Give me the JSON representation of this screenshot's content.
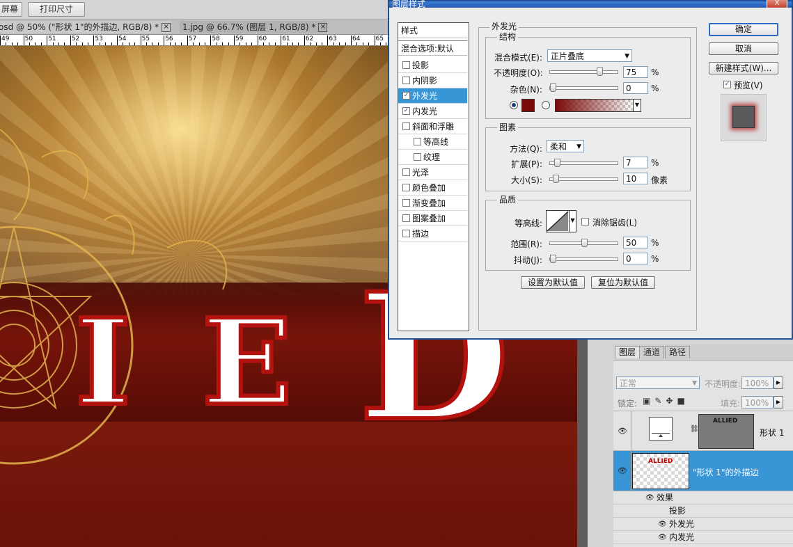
{
  "toolbar": {
    "btn_left": "屏幕",
    "btn_print": "打印尺寸"
  },
  "doc_tabs": [
    {
      "label": "osd @ 50% (\"形状 1\"的外描边, RGB/8) *"
    },
    {
      "label": "1.jpg @ 66.7% (图层 1, RGB/8) *"
    }
  ],
  "ruler": [
    "49",
    "50",
    "51",
    "52",
    "53",
    "54",
    "55",
    "56",
    "57",
    "58",
    "59",
    "60",
    "61",
    "62",
    "63",
    "64",
    "65"
  ],
  "canvas": {
    "letters": [
      "I",
      "E",
      "D"
    ]
  },
  "dialog": {
    "title": "图层样式",
    "close_label": "X",
    "style_list": {
      "header": "样式",
      "blend_default": "混合选项:默认",
      "items": [
        {
          "label": "投影",
          "checked": false,
          "sub": false
        },
        {
          "label": "内阴影",
          "checked": false,
          "sub": false
        },
        {
          "label": "外发光",
          "checked": true,
          "sub": false,
          "selected": true
        },
        {
          "label": "内发光",
          "checked": true,
          "sub": false
        },
        {
          "label": "斜面和浮雕",
          "checked": false,
          "sub": false
        },
        {
          "label": "等高线",
          "checked": false,
          "sub": true
        },
        {
          "label": "纹理",
          "checked": false,
          "sub": true
        },
        {
          "label": "光泽",
          "checked": false,
          "sub": false
        },
        {
          "label": "颜色叠加",
          "checked": false,
          "sub": false
        },
        {
          "label": "渐变叠加",
          "checked": false,
          "sub": false
        },
        {
          "label": "图案叠加",
          "checked": false,
          "sub": false
        },
        {
          "label": "描边",
          "checked": false,
          "sub": false
        }
      ]
    },
    "outer_glow": {
      "title": "外发光",
      "structure": {
        "title": "结构",
        "blend_mode_label": "混合模式(E):",
        "blend_mode_value": "正片叠底",
        "opacity_label": "不透明度(O):",
        "opacity_value": "75",
        "opacity": 0.75,
        "noise_label": "杂色(N):",
        "noise_value": "0",
        "noise": 0,
        "unit_pct": "%",
        "glow_color": "#7a0a08"
      },
      "elements": {
        "title": "图素",
        "technique_label": "方法(Q):",
        "technique_value": "柔和",
        "spread_label": "扩展(P):",
        "spread_value": "7",
        "spread": 0.07,
        "size_label": "大小(S):",
        "size_value": "10",
        "size": 0.04,
        "unit_pct": "%",
        "unit_px": "像素"
      },
      "quality": {
        "title": "品质",
        "contour_label": "等高线:",
        "anti_alias_label": "消除锯齿(L)",
        "range_label": "范围(R):",
        "range_value": "50",
        "range": 0.5,
        "jitter_label": "抖动(J):",
        "jitter_value": "0",
        "jitter": 0,
        "unit_pct": "%"
      },
      "make_default": "设置为默认值",
      "reset_default": "复位为默认值"
    },
    "buttons": {
      "ok": "确定",
      "cancel": "取消",
      "new_style": "新建样式(W)...",
      "preview": "预览(V)"
    }
  },
  "layers_panel": {
    "tabs": [
      "图层",
      "通道",
      "路径"
    ],
    "blend_mode": "正常",
    "opacity_label": "不透明度:",
    "opacity_value": "100%",
    "lock_label": "锁定:",
    "fill_label": "填充:",
    "fill_value": "100%",
    "layers": [
      {
        "name": "形状 1"
      },
      {
        "name": "\"形状 1\"的外描边"
      }
    ],
    "effects_label": "效果",
    "effects": [
      {
        "name": "投影",
        "visible": false
      },
      {
        "name": "外发光",
        "visible": true
      },
      {
        "name": "内发光",
        "visible": true
      }
    ]
  }
}
